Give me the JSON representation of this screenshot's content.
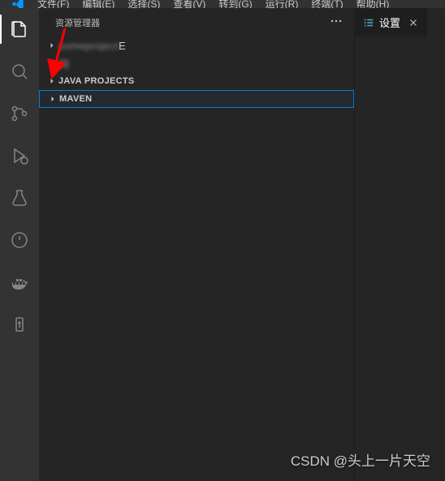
{
  "menubar": {
    "items": [
      "文件(F)",
      "编辑(E)",
      "选择(S)",
      "查看(V)",
      "转到(G)",
      "运行(R)",
      "终端(T)",
      "帮助(H)"
    ]
  },
  "sidebar": {
    "title": "资源管理器",
    "items": [
      {
        "label": "E",
        "blurPrefix": "someproject"
      },
      {
        "label": "",
        "blurPrefix": "网"
      },
      {
        "label": "JAVA PROJECTS"
      },
      {
        "label": "MAVEN",
        "selected": true
      }
    ]
  },
  "editor": {
    "tab": {
      "label": "设置"
    }
  },
  "watermark": "CSDN @头上一片天空"
}
